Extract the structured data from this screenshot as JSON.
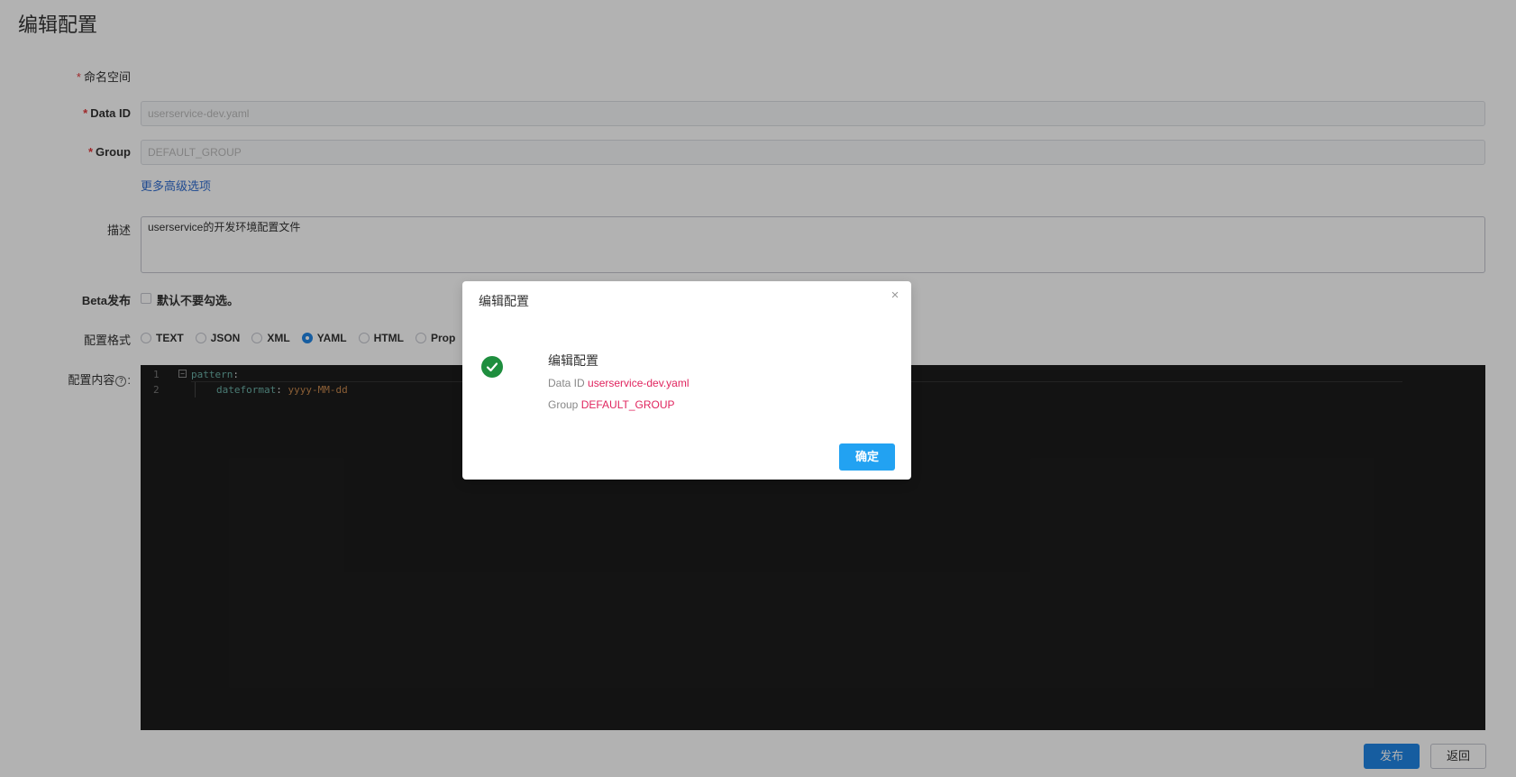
{
  "page": {
    "title": "编辑配置"
  },
  "form": {
    "namespace_label": "命名空间",
    "dataid_label": "Data ID",
    "dataid_value": "userservice-dev.yaml",
    "group_label": "Group",
    "group_value": "DEFAULT_GROUP",
    "advanced_link": "更多高级选项",
    "desc_label": "描述",
    "desc_value": "userservice的开发环境配置文件",
    "beta_label": "Beta发布",
    "beta_checkbox_label": "默认不要勾选。",
    "format_label": "配置格式",
    "formats": [
      "TEXT",
      "JSON",
      "XML",
      "YAML",
      "HTML",
      "Prop"
    ],
    "selected_format": "YAML",
    "content_label": "配置内容",
    "content_label_suffix": ":",
    "help_icon": "?",
    "required_mark": "*"
  },
  "editor": {
    "lines": [
      {
        "num": "1",
        "fold": "−",
        "key": "pattern",
        "punc": ":",
        "value": ""
      },
      {
        "num": "2",
        "fold": "",
        "key": "dateformat",
        "punc": ": ",
        "value": "yyyy-MM-dd"
      }
    ]
  },
  "actions": {
    "publish": "发布",
    "back": "返回"
  },
  "dialog": {
    "title": "编辑配置",
    "close_icon": "×",
    "status_icon": "check-circle-icon",
    "message_title": "编辑配置",
    "dataid_label": "Data ID",
    "dataid_value": "userservice-dev.yaml",
    "group_label": "Group",
    "group_value": "DEFAULT_GROUP",
    "ok_label": "确定"
  },
  "colors": {
    "primary": "#2086e6",
    "success": "#1e8e3e",
    "highlight": "#e0245e",
    "editor_bg": "#1c1c1c"
  }
}
